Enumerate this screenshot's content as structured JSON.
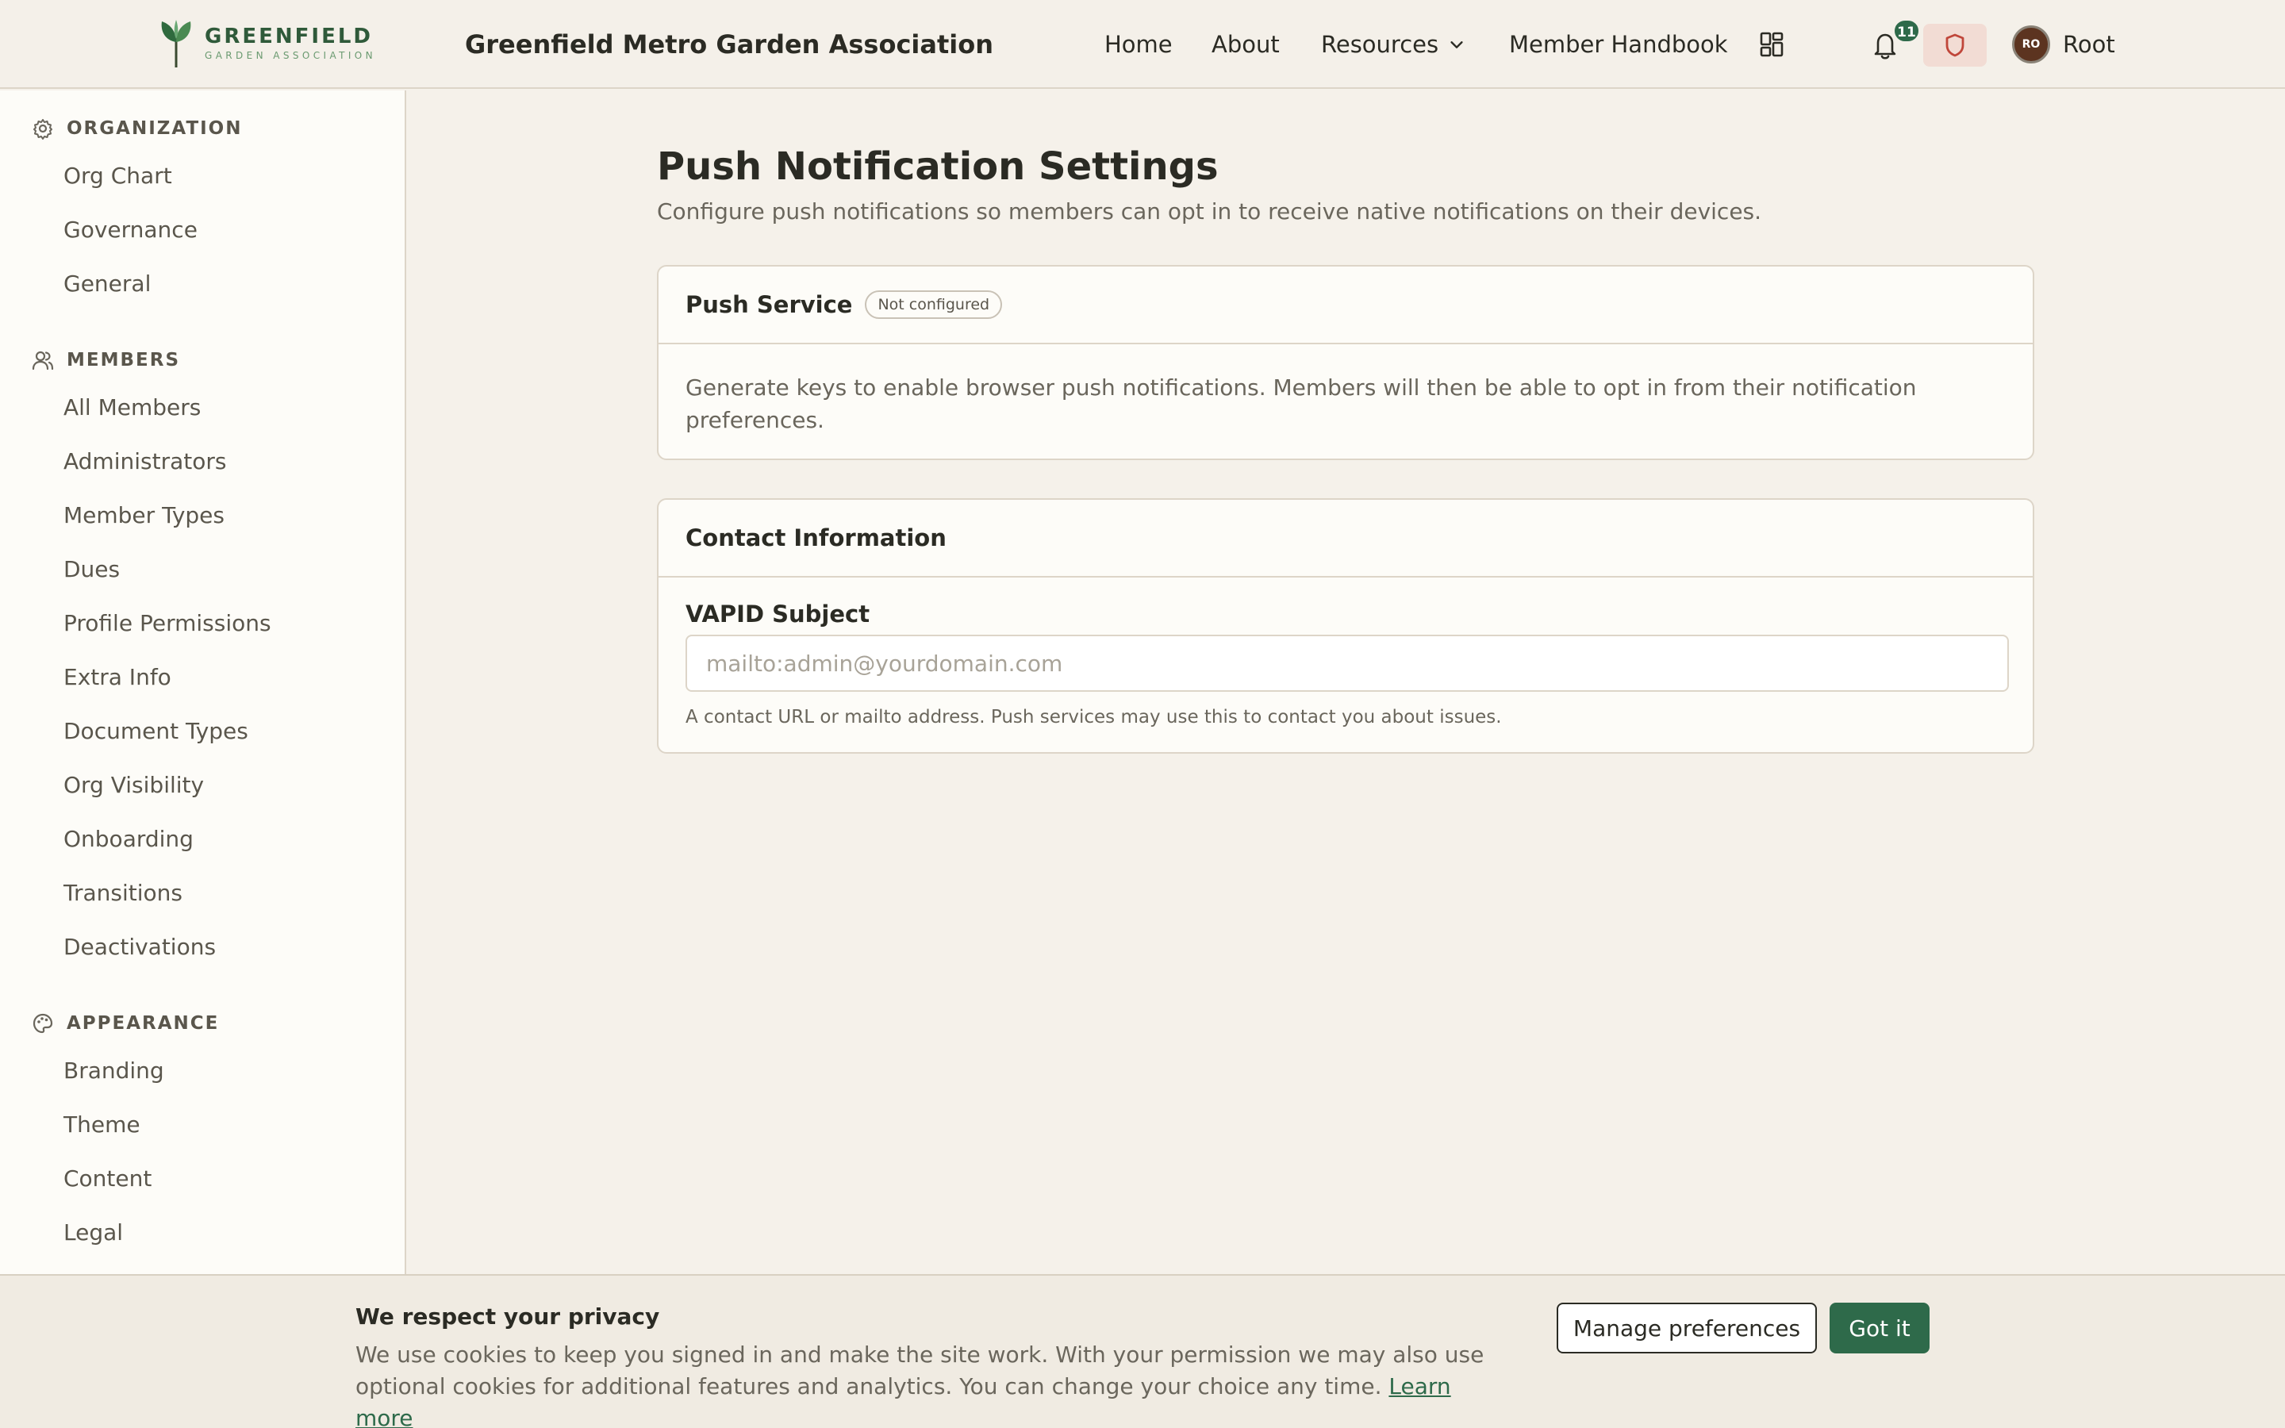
{
  "header": {
    "logo_name": "GREENFIELD",
    "logo_sub": "GARDEN ASSOCIATION",
    "site_title": "Greenfield Metro Garden Association",
    "nav": {
      "home": "Home",
      "about": "About",
      "resources": "Resources",
      "handbook": "Member Handbook"
    },
    "notification_count": "11",
    "avatar_initials": "RO",
    "user_name": "Root",
    "icons": [
      "leaf-logo",
      "chevron-down-icon",
      "apps-grid-icon",
      "bell-icon",
      "shield-icon"
    ]
  },
  "sidebar": {
    "sections": [
      {
        "title": "ORGANIZATION",
        "icon": "gear-icon",
        "items": [
          "Org Chart",
          "Governance",
          "General"
        ]
      },
      {
        "title": "MEMBERS",
        "icon": "users-icon",
        "items": [
          "All Members",
          "Administrators",
          "Member Types",
          "Dues",
          "Profile Permissions",
          "Extra Info",
          "Document Types",
          "Org Visibility",
          "Onboarding",
          "Transitions",
          "Deactivations"
        ]
      },
      {
        "title": "APPEARANCE",
        "icon": "palette-icon",
        "items": [
          "Branding",
          "Theme",
          "Content",
          "Legal"
        ]
      }
    ]
  },
  "main": {
    "title": "Push Notification Settings",
    "subtitle": "Configure push notifications so members can opt in to receive native notifications on their devices.",
    "push_service": {
      "title": "Push Service",
      "status": "Not configured",
      "body": "Generate keys to enable browser push notifications. Members will then be able to opt in from their notification preferences."
    },
    "contact": {
      "title": "Contact Information",
      "field_label": "VAPID Subject",
      "placeholder": "mailto:admin@yourdomain.com",
      "value": "",
      "help": "A contact URL or mailto address. Push services may use this to contact you about issues."
    }
  },
  "cookie": {
    "title": "We respect your privacy",
    "text": "We use cookies to keep you signed in and make the site work. With your permission we may also use optional cookies for additional features and analytics. You can change your choice any time.",
    "learn_more": "Learn more",
    "manage_label": "Manage preferences",
    "accept_label": "Got it"
  },
  "colors": {
    "brand": "#2e6a4a",
    "background": "#f5f1ea",
    "surface": "#fdfcf8",
    "border": "#ddd5c8",
    "alert_bg": "#f2dcd4",
    "alert_icon": "#c0463a"
  }
}
